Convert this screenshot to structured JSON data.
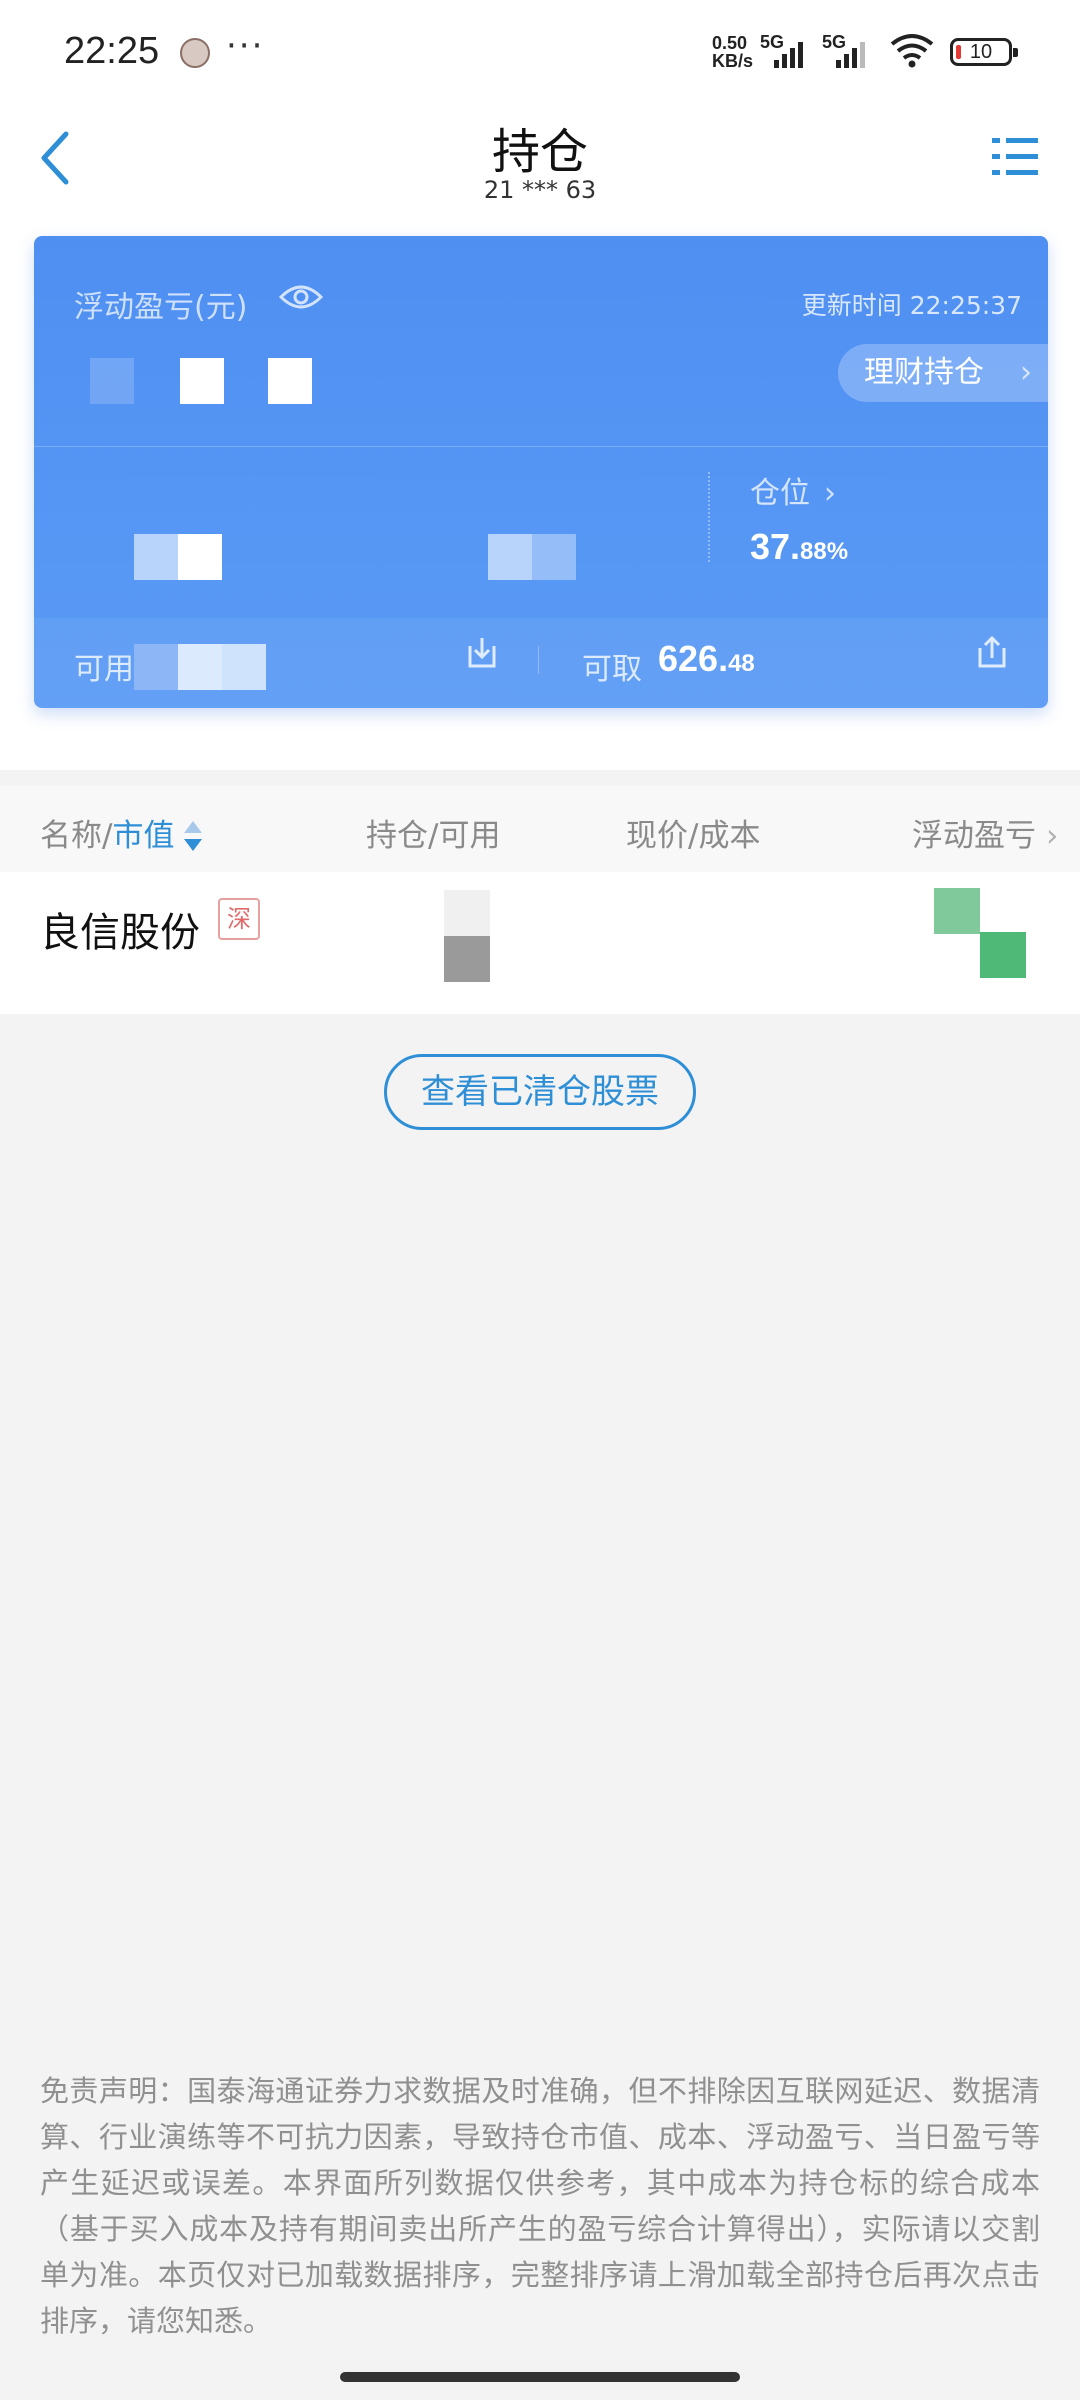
{
  "status_bar": {
    "time": "22:25",
    "more": "···",
    "net_speed_value": "0.50",
    "net_speed_unit": "KB/s",
    "signal1_label": "5G",
    "signal2_label": "5G",
    "battery": "10"
  },
  "header": {
    "title": "持仓",
    "account": "21 *** 63"
  },
  "summary": {
    "pnl_label": "浮动盈亏(元)",
    "update_time": "更新时间 22:25:37",
    "wealth_button": "理财持仓",
    "position_label": "仓位",
    "position_value_int": "37.",
    "position_value_dec": "88%",
    "available_label": "可用",
    "withdraw_label": "可取",
    "withdraw_value_int": "626.",
    "withdraw_value_dec": "48"
  },
  "table": {
    "col_name_prefix": "名称/",
    "col_name_accent": "市值",
    "col_qty": "持仓/可用",
    "col_price": "现价/成本",
    "col_pnl": "浮动盈亏",
    "rows": [
      {
        "name": "良信股份",
        "market": "深"
      }
    ]
  },
  "cleared_button": "查看已清仓股票",
  "disclaimer": "免责声明：国泰海通证券力求数据及时准确，但不排除因互联网延迟、数据清算、行业演练等不可抗力因素，导致持仓市值、成本、浮动盈亏、当日盈亏等产生延迟或误差。本界面所列数据仅供参考，其中成本为持仓标的综合成本（基于买入成本及持有期间卖出所产生的盈亏综合计算得出），实际请以交割单为准。本页仅对已加载数据排序，完整排序请上滑加载全部持仓后再次点击排序，请您知悉。",
  "colors": {
    "accent": "#2f8fd6",
    "card_blue": "#5596f4",
    "market_tag": "#e06a6a"
  }
}
